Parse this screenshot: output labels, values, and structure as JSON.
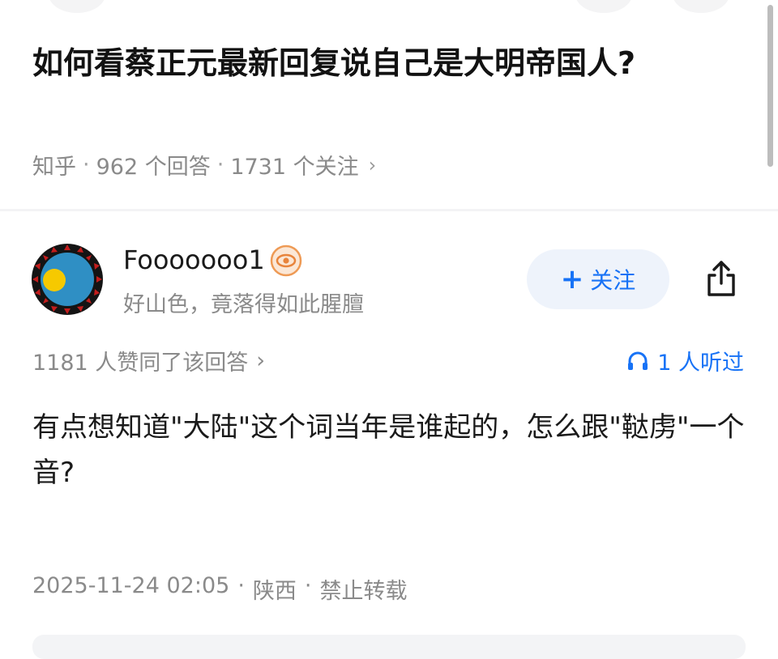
{
  "question": {
    "title": "如何看蔡正元最新回复说自己是大明帝国人?",
    "source": "知乎",
    "answer_count": "962 个回答",
    "follow_count": "1731 个关注",
    "meta_arrow": "›"
  },
  "answer": {
    "author": {
      "name": "Fooooooo1",
      "bio": "好山色，竟落得如此腥膻",
      "badge_icon": "eye-badge-icon"
    },
    "follow_button": {
      "icon": "plus-icon",
      "label": "关注"
    },
    "share_icon": "share-icon",
    "upvote_text": "1181 人赞同了该回答",
    "upvote_arrow": "›",
    "listen": {
      "icon": "headphones-icon",
      "text": "1 人听过"
    },
    "content": "有点想知道\"大陆\"这个词当年是谁起的，怎么跟\"鞑虏\"一个音?",
    "date": "2025-11-24 02:05",
    "location": "陕西",
    "copyright": "禁止转载"
  },
  "colors": {
    "accent": "#1772f6",
    "follow_bg": "#eef3fb",
    "muted_text": "#8a8a8a"
  }
}
